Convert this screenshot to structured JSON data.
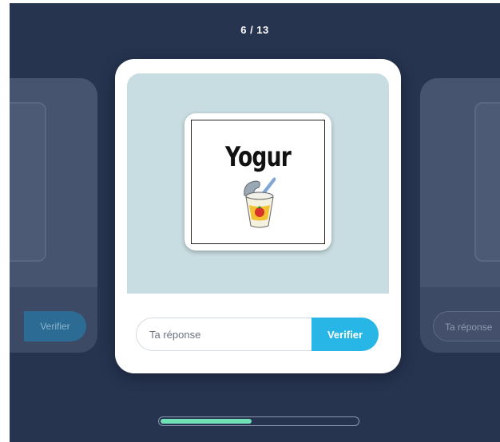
{
  "counter": "6 / 13",
  "colors": {
    "background": "#263450",
    "accent": "#28b6e6",
    "progress": "#6fe0b8",
    "card_image_bg": "#c8dde1"
  },
  "card": {
    "word": "Yogur",
    "image_icon": "yogurt-cup-icon",
    "input_placeholder": "Ta réponse",
    "verify_label": "Verifier"
  },
  "left_card": {
    "verify_label": "Verifier"
  },
  "right_card": {
    "input_placeholder": "Ta réponse"
  },
  "progress": {
    "current": 6,
    "total": 13
  }
}
